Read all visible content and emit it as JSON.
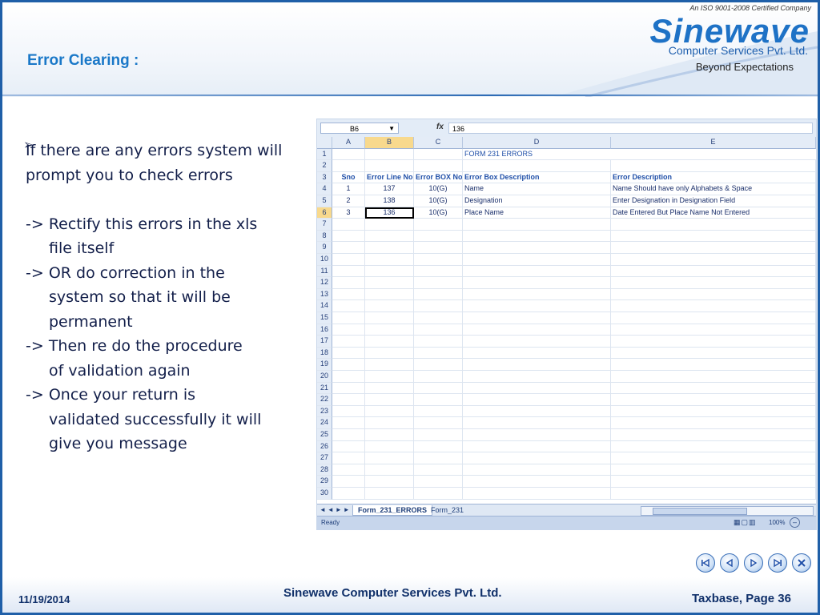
{
  "slide": {
    "title": "Error Clearing :",
    "logo": {
      "iso": "An ISO 9001-2008 Certified Company",
      "brand": "Sinewave",
      "subtitle": "Computer Services Pvt. Ltd.",
      "tagline": "Beyond Expectations"
    },
    "bullet_icon": "arrow-bullet-icon",
    "text_lines": [
      {
        "text": "If there are any errors system will",
        "indent": false
      },
      {
        "text": "prompt you to check errors",
        "indent": false
      },
      {
        "text": "",
        "indent": false
      },
      {
        "text": "-> Rectify this errors in the xls",
        "indent": false
      },
      {
        "text": "file itself",
        "indent": true
      },
      {
        "text": "-> OR do correction in the",
        "indent": false
      },
      {
        "text": "system so that it will be",
        "indent": true
      },
      {
        "text": "permanent",
        "indent": true
      },
      {
        "text": "-> Then re do the procedure",
        "indent": false
      },
      {
        "text": "of validation again",
        "indent": true
      },
      {
        "text": "-> Once your return is",
        "indent": false
      },
      {
        "text": "validated successfully it will",
        "indent": true
      },
      {
        "text": "give you message",
        "indent": true
      }
    ]
  },
  "excel": {
    "name_box": "B6",
    "fx_label": "fx",
    "formula_value": "136",
    "columns": [
      "A",
      "B",
      "C",
      "D",
      "E"
    ],
    "selected_column": "B",
    "selected_row": 6,
    "sheet_title": "FORM  231  ERRORS",
    "header_row": [
      "Sno",
      "Error Line No",
      "Error BOX No",
      "Error Box Description",
      "Error Description"
    ],
    "data_rows": [
      [
        "1",
        "137",
        "10(G)",
        "Name",
        "Name Should have only Alphabets & Space"
      ],
      [
        "2",
        "138",
        "10(G)",
        "Designation",
        "Enter Designation in Designation Field"
      ],
      [
        "3",
        "136",
        "10(G)",
        "Place Name",
        "Date Entered But Place Name Not Entered"
      ]
    ],
    "row_count": 30,
    "tabs": [
      "Form_231_ERRORS",
      "Form_231"
    ],
    "active_tab": "Form_231_ERRORS",
    "status": "Ready",
    "zoom": "100%"
  },
  "footer": {
    "date": "11/19/2014",
    "company": "Sinewave Computer Services Pvt. Ltd.",
    "page": "Taxbase, Page 36"
  },
  "nav_buttons": [
    "first-slide-icon",
    "previous-slide-icon",
    "next-slide-icon",
    "last-slide-icon",
    "close-icon"
  ],
  "colors": {
    "frame": "#1f5fa8",
    "title": "#1a78c8",
    "body_text": "#131f4a",
    "excel_header": "#1f4fa8",
    "selection": "#f8d98d"
  }
}
